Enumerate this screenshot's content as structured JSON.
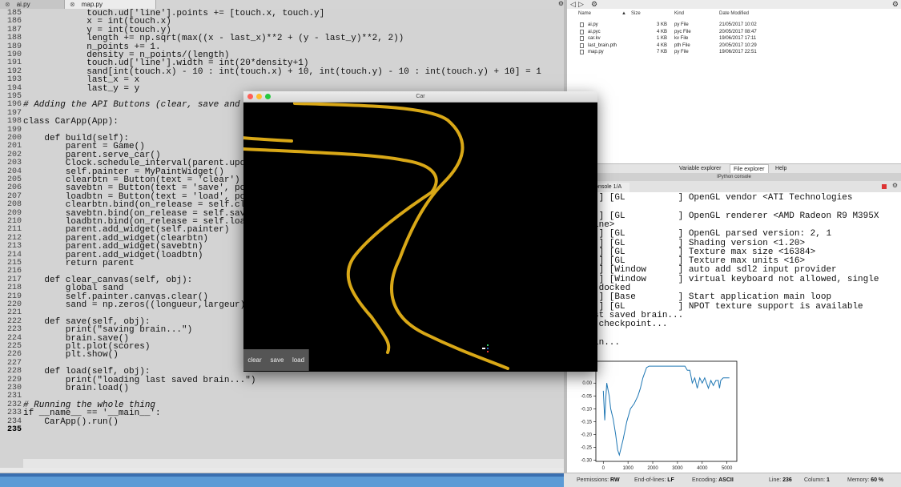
{
  "editor": {
    "tabs": [
      {
        "label": "ai.py"
      },
      {
        "label": "map.py"
      }
    ],
    "lines": [
      {
        "n": "185",
        "t": "            touch.ud['line'].points += [touch.x, touch.y]"
      },
      {
        "n": "186",
        "t": "            x = int(touch.x)"
      },
      {
        "n": "187",
        "t": "            y = int(touch.y)"
      },
      {
        "n": "188",
        "t": "            length += np.sqrt(max((x - last_x)**2 + (y - last_y)**2, 2))"
      },
      {
        "n": "189",
        "t": "            n_points += 1."
      },
      {
        "n": "190",
        "t": "            density = n_points/(length)"
      },
      {
        "n": "191",
        "t": "            touch.ud['line'].width = int(20*density+1)"
      },
      {
        "n": "192",
        "t": "            sand[int(touch.x) - 10 : int(touch.x) + 10, int(touch.y) - 10 : int(touch.y) + 10] = 1"
      },
      {
        "n": "193",
        "t": "            last_x = x"
      },
      {
        "n": "194",
        "t": "            last_y = y"
      },
      {
        "n": "195",
        "t": ""
      },
      {
        "n": "196",
        "t": "# Adding the API Buttons (clear, save and"
      },
      {
        "n": "197",
        "t": ""
      },
      {
        "n": "198",
        "t": "class CarApp(App):"
      },
      {
        "n": "199",
        "t": ""
      },
      {
        "n": "200",
        "t": "    def build(self):"
      },
      {
        "n": "201",
        "t": "        parent = Game()"
      },
      {
        "n": "202",
        "t": "        parent.serve_car()"
      },
      {
        "n": "203",
        "t": "        Clock.schedule_interval(parent.upd"
      },
      {
        "n": "204",
        "t": "        self.painter = MyPaintWidget()"
      },
      {
        "n": "205",
        "t": "        clearbtn = Button(text = 'clear')"
      },
      {
        "n": "206",
        "t": "        savebtn = Button(text = 'save', po"
      },
      {
        "n": "207",
        "t": "        loadbtn = Button(text = 'load', po"
      },
      {
        "n": "208",
        "t": "        clearbtn.bind(on_release = self.cl"
      },
      {
        "n": "209",
        "t": "        savebtn.bind(on_release = self.sav"
      },
      {
        "n": "210",
        "t": "        loadbtn.bind(on_release = self.loa"
      },
      {
        "n": "211",
        "t": "        parent.add_widget(self.painter)"
      },
      {
        "n": "212",
        "t": "        parent.add_widget(clearbtn)"
      },
      {
        "n": "213",
        "t": "        parent.add_widget(savebtn)"
      },
      {
        "n": "214",
        "t": "        parent.add_widget(loadbtn)"
      },
      {
        "n": "215",
        "t": "        return parent"
      },
      {
        "n": "216",
        "t": ""
      },
      {
        "n": "217",
        "t": "    def clear_canvas(self, obj):"
      },
      {
        "n": "218",
        "t": "        global sand"
      },
      {
        "n": "219",
        "t": "        self.painter.canvas.clear()"
      },
      {
        "n": "220",
        "t": "        sand = np.zeros((longueur,largeur)"
      },
      {
        "n": "221",
        "t": ""
      },
      {
        "n": "222",
        "t": "    def save(self, obj):"
      },
      {
        "n": "223",
        "t": "        print(\"saving brain...\")"
      },
      {
        "n": "224",
        "t": "        brain.save()"
      },
      {
        "n": "225",
        "t": "        plt.plot(scores)"
      },
      {
        "n": "226",
        "t": "        plt.show()"
      },
      {
        "n": "227",
        "t": ""
      },
      {
        "n": "228",
        "t": "    def load(self, obj):"
      },
      {
        "n": "229",
        "t": "        print(\"loading last saved brain...\")"
      },
      {
        "n": "230",
        "t": "        brain.load()"
      },
      {
        "n": "231",
        "t": ""
      },
      {
        "n": "232",
        "t": "# Running the whole thing"
      },
      {
        "n": "233",
        "t": "if __name__ == '__main__':"
      },
      {
        "n": "234",
        "t": "    CarApp().run()"
      },
      {
        "n": "235",
        "t": ""
      }
    ]
  },
  "file_explorer": {
    "headers": {
      "name": "Name",
      "size": "Size",
      "kind": "Kind",
      "date": "Date Modified"
    },
    "files": [
      {
        "name": "ai.py",
        "size": "3 KB",
        "kind": "py File",
        "date": "21/05/2017 10:02"
      },
      {
        "name": "ai.pyc",
        "size": "4 KB",
        "kind": "pyc File",
        "date": "20/05/2017 08:47"
      },
      {
        "name": "car.kv",
        "size": "1 KB",
        "kind": "kv File",
        "date": "19/06/2017 17:11"
      },
      {
        "name": "last_brain.pth",
        "size": "4 KB",
        "kind": "pth File",
        "date": "20/05/2017 10:29"
      },
      {
        "name": "map.py",
        "size": "7 KB",
        "kind": "py File",
        "date": "19/06/2017 22:51"
      }
    ],
    "pane_tabs": [
      "Variable explorer",
      "File explorer",
      "Help"
    ]
  },
  "ipython": {
    "title": "IPython console",
    "tab": "Console 1/A",
    "lines": [
      "      ] [GL          ] OpenGL vendor <ATI Technologies",
      "",
      "      ] [GL          ] OpenGL renderer <AMD Radeon R9 M395X",
      "L Engine>",
      "      ] [GL          ] OpenGL parsed version: 2, 1",
      "      ] [GL          ] Shading version <1.20>",
      "      ] [GL          ] Texture max size <16384>",
      "      ] [GL          ] Texture max units <16>",
      "      ] [Window      ] auto add sdl2 input provider",
      "      ] [Window      ] virtual keyboard not allowed, single",
      "  not docked",
      "      ] [Base        ] Start application main loop",
      "      ] [GL          ] NPOT texture support is available",
      "ng last saved brain...",
      "ading checkpoint...",
      "!",
      "g brain..."
    ]
  },
  "chart_data": {
    "type": "line",
    "yticks": [
      "0.05",
      "0.00",
      "-0.05",
      "-0.10",
      "-0.15",
      "-0.20",
      "-0.25",
      "-0.30"
    ],
    "xticks": [
      "0",
      "1000",
      "2000",
      "3000",
      "4000",
      "5000"
    ],
    "xlim": [
      -300,
      5400
    ],
    "ylim": [
      -0.305,
      0.085
    ],
    "series": [
      {
        "color": "#1f77b4",
        "points": [
          [
            0,
            -0.03
          ],
          [
            60,
            -0.145
          ],
          [
            100,
            -0.06
          ],
          [
            140,
            0.0
          ],
          [
            180,
            -0.02
          ],
          [
            240,
            -0.05
          ],
          [
            300,
            -0.1
          ],
          [
            400,
            -0.14
          ],
          [
            500,
            -0.2
          ],
          [
            580,
            -0.26
          ],
          [
            650,
            -0.28
          ],
          [
            700,
            -0.26
          ],
          [
            800,
            -0.22
          ],
          [
            950,
            -0.15
          ],
          [
            1100,
            -0.1
          ],
          [
            1250,
            -0.08
          ],
          [
            1400,
            -0.05
          ],
          [
            1500,
            -0.02
          ],
          [
            1600,
            0.02
          ],
          [
            1750,
            0.06
          ],
          [
            1850,
            0.066
          ],
          [
            2600,
            0.066
          ],
          [
            3300,
            0.066
          ],
          [
            3400,
            0.05
          ],
          [
            3500,
            0.05
          ],
          [
            3600,
            0.0
          ],
          [
            3700,
            0.02
          ],
          [
            3800,
            -0.02
          ],
          [
            3900,
            0.02
          ],
          [
            4000,
            0.0
          ],
          [
            4100,
            0.02
          ],
          [
            4250,
            -0.02
          ],
          [
            4350,
            0.01
          ],
          [
            4450,
            -0.01
          ],
          [
            4550,
            0.01
          ],
          [
            4650,
            0.01
          ],
          [
            4700,
            -0.02
          ],
          [
            4750,
            0.01
          ],
          [
            4850,
            0.02
          ],
          [
            5100,
            0.02
          ]
        ]
      }
    ]
  },
  "car_app": {
    "title": "Car",
    "buttons": {
      "clear": "clear",
      "save": "save",
      "load": "load"
    },
    "road_color": "#d9a817"
  },
  "status": {
    "permissions": {
      "label": "Permissions:",
      "value": "RW"
    },
    "eol": {
      "label": "End-of-lines:",
      "value": "LF"
    },
    "encoding": {
      "label": "Encoding:",
      "value": "ASCII"
    },
    "line": {
      "label": "Line:",
      "value": "236"
    },
    "column": {
      "label": "Column:",
      "value": "1"
    },
    "memory": {
      "label": "Memory:",
      "value": "60 %"
    }
  }
}
